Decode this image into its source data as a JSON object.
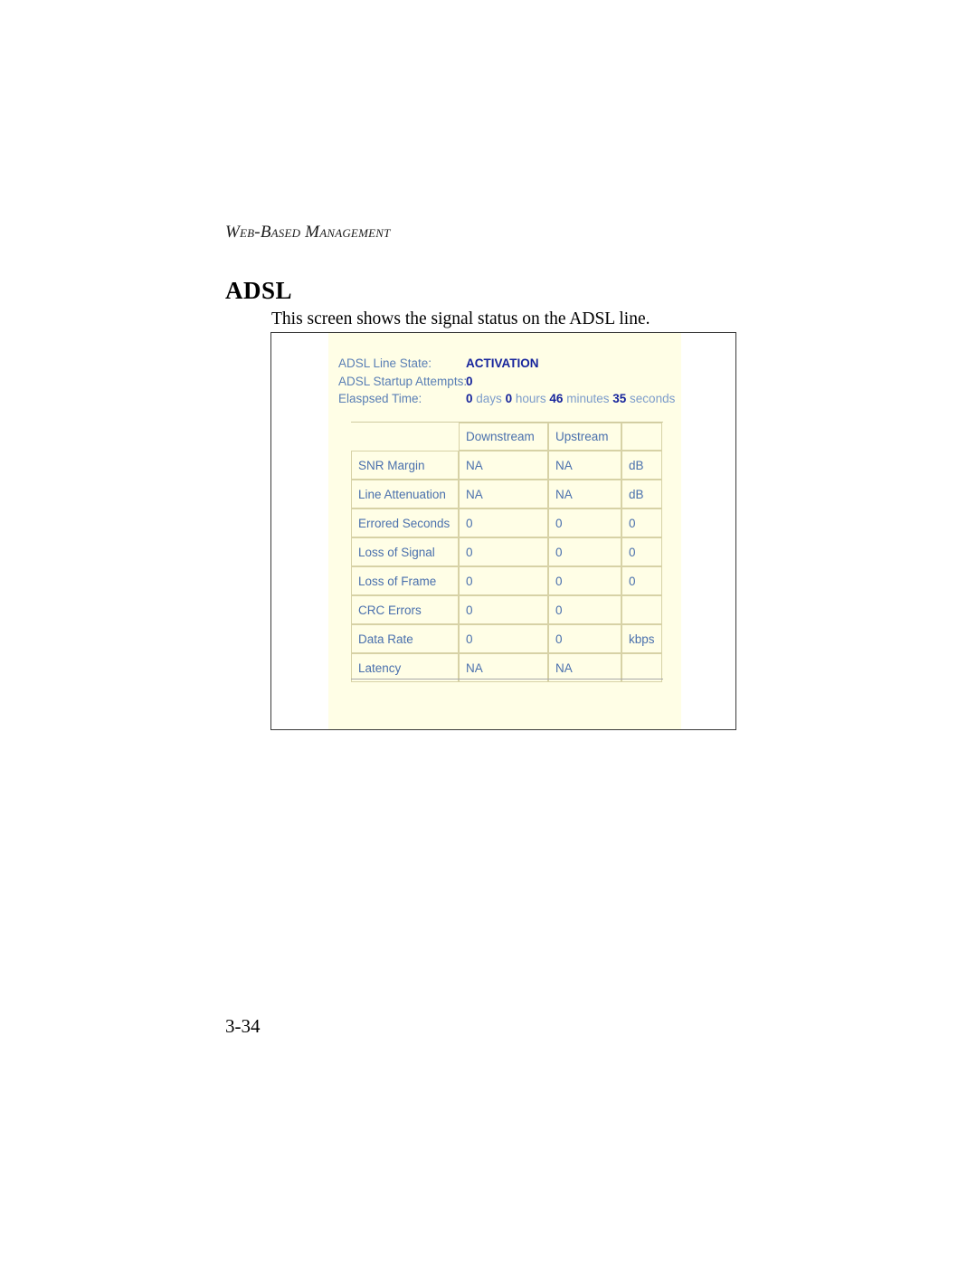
{
  "page": {
    "running_head": "Web-Based Management",
    "section_title": "ADSL",
    "intro_text": "This screen shows the signal status on the ADSL line.",
    "folio": "3-34"
  },
  "colors": {
    "panel_background": "#FFFEE6",
    "label_blue": "#5A7FB5",
    "value_navy": "#16249C",
    "unit_soft_blue": "#7C9CCB",
    "table_border": "#D7D2A6",
    "frame_border": "#3A3A3A"
  },
  "status": {
    "line_state": {
      "label": "ADSL Line State:",
      "value": "ACTIVATION"
    },
    "startup_attempts": {
      "label": "ADSL Startup Attempts:",
      "value": "0"
    },
    "elapsed_time": {
      "label": "Elaspsed Time:",
      "days_value": "0",
      "days_unit": "days",
      "hours_value": "0",
      "hours_unit": "hours",
      "minutes_value": "46",
      "minutes_unit": "minutes",
      "seconds_value": "35",
      "seconds_unit": "seconds"
    }
  },
  "table": {
    "headers": {
      "row_label": "",
      "downstream": "Downstream",
      "upstream": "Upstream",
      "unit": ""
    },
    "rows": [
      {
        "label": "SNR Margin",
        "downstream": "NA",
        "upstream": "NA",
        "unit": "dB"
      },
      {
        "label": "Line Attenuation",
        "downstream": "NA",
        "upstream": "NA",
        "unit": "dB"
      },
      {
        "label": "Errored Seconds",
        "downstream": "0",
        "upstream": "0",
        "unit": "0"
      },
      {
        "label": "Loss of Signal",
        "downstream": "0",
        "upstream": "0",
        "unit": "0"
      },
      {
        "label": "Loss of Frame",
        "downstream": "0",
        "upstream": "0",
        "unit": "0"
      },
      {
        "label": "CRC Errors",
        "downstream": "0",
        "upstream": "0",
        "unit": ""
      },
      {
        "label": "Data Rate",
        "downstream": "0",
        "upstream": "0",
        "unit": "kbps"
      },
      {
        "label": "Latency",
        "downstream": "NA",
        "upstream": "NA",
        "unit": ""
      }
    ]
  }
}
